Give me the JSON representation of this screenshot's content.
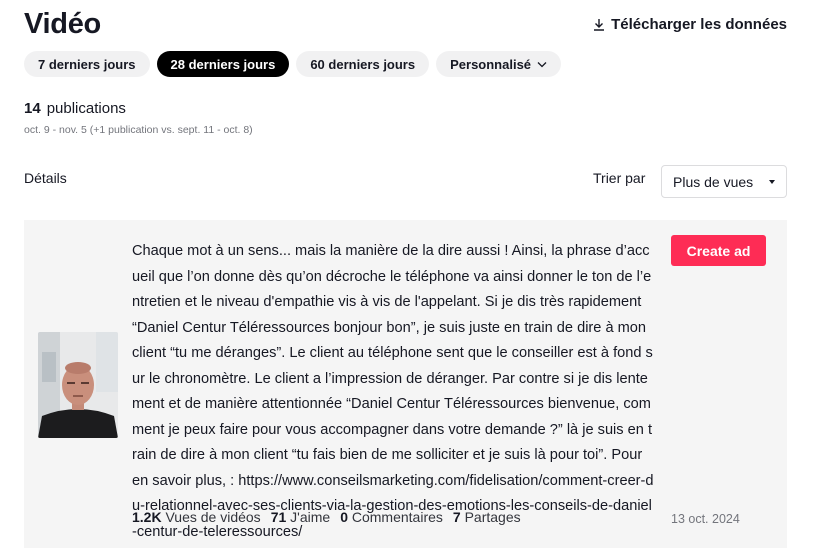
{
  "page": {
    "title": "Vidéo"
  },
  "header": {
    "download_label": "Télécharger les données",
    "download_icon": "download-icon"
  },
  "tabs": [
    {
      "label": "7 derniers jours",
      "active": false
    },
    {
      "label": "28 derniers jours",
      "active": true
    },
    {
      "label": "60 derniers jours",
      "active": false
    },
    {
      "label": "Personnalisé",
      "active": false,
      "icon": "chevron-down-icon"
    }
  ],
  "summary": {
    "count": "14",
    "count_label": "publications",
    "range": "oct. 9 - nov. 5 (+1 publication vs. sept. 11 - oct. 8)"
  },
  "details": {
    "label": "Détails",
    "sort_label": "Trier par",
    "sort_value": "Plus de vues"
  },
  "post": {
    "caption": "Chaque mot à un sens... mais la manière de la dire aussi ! Ainsi, la phrase d’accueil que l’on donne dès qu’on décroche le téléphone va ainsi donner le ton de l’entretien et le niveau d'empathie vis à vis de l'appelant. Si je dis très rapidement “Daniel Centur Téléressources bonjour bon”, je suis juste en train de dire à mon client “tu me déranges”. Le client au téléphone sent que le conseiller est à fond sur le chronomètre. Le client a l’impression de déranger. Par contre si je dis lentement et de manière attentionnée “Daniel Centur Téléressources bienvenue, comment je peux faire pour vous accompagner dans votre demande ?” là je suis en train de dire à mon client “tu fais bien de me solliciter et je suis là pour toi”. Pour en savoir plus, : https://www.conseilsmarketing.com/fidelisation/comment-creer-du-relationnel-avec-ses-clients-via-la-gestion-des-emotions-les-conseils-de-daniel-centur-de-teleressources/",
    "create_ad_label": "Create ad",
    "accent_color": "#fe2c55",
    "stats": [
      {
        "value": "1.2K",
        "label": "Vues de vidéos"
      },
      {
        "value": "71",
        "label": "J'aime"
      },
      {
        "value": "0",
        "label": "Commentaires"
      },
      {
        "value": "7",
        "label": "Partages"
      }
    ],
    "date": "13 oct. 2024"
  }
}
